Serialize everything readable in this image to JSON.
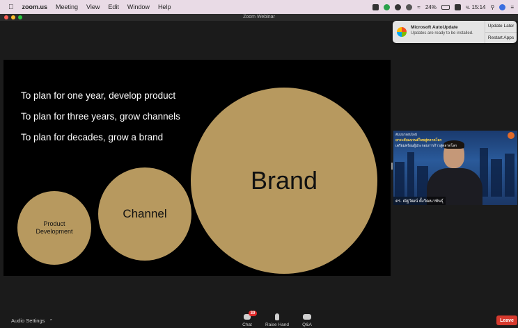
{
  "menubar": {
    "app_name": "zoom.us",
    "menus": [
      "Meeting",
      "View",
      "Edit",
      "Window",
      "Help"
    ],
    "battery": "24%",
    "clock": "ч. 15:14"
  },
  "window": {
    "title": "Zoom Webinar"
  },
  "notification": {
    "title": "Microsoft AutoUpdate",
    "message": "Updates are ready to be installed.",
    "btn_update_later": "Update Later",
    "btn_restart": "Restart Apps"
  },
  "slide": {
    "lines": [
      "To plan for one year, develop product",
      "To plan for three years, grow channels",
      "To plan for decades, grow a brand"
    ],
    "circle_product": "Product Development",
    "circle_channel": "Channel",
    "circle_brand": "Brand",
    "circle_color": "#b7995f"
  },
  "video": {
    "banner1": "สัมมนาออนไลน์",
    "banner2": "ยกระดับแบรนด์ไทยสู่ตลาดโลก",
    "banner3": "เตรียมพร้อมผู้ประกอบการก้าวสู่ตลาดโลก",
    "participant_name": "ดร. ณัฐวัฒน์ ตั้งวิฒนาพันธุ์"
  },
  "toolbar": {
    "audio_settings": "Audio Settings",
    "chat_label": "Chat",
    "chat_badge": "30",
    "raise_hand_label": "Raise Hand",
    "qa_label": "Q&A",
    "leave_label": "Leave",
    "leave_color": "#d63a2e"
  }
}
